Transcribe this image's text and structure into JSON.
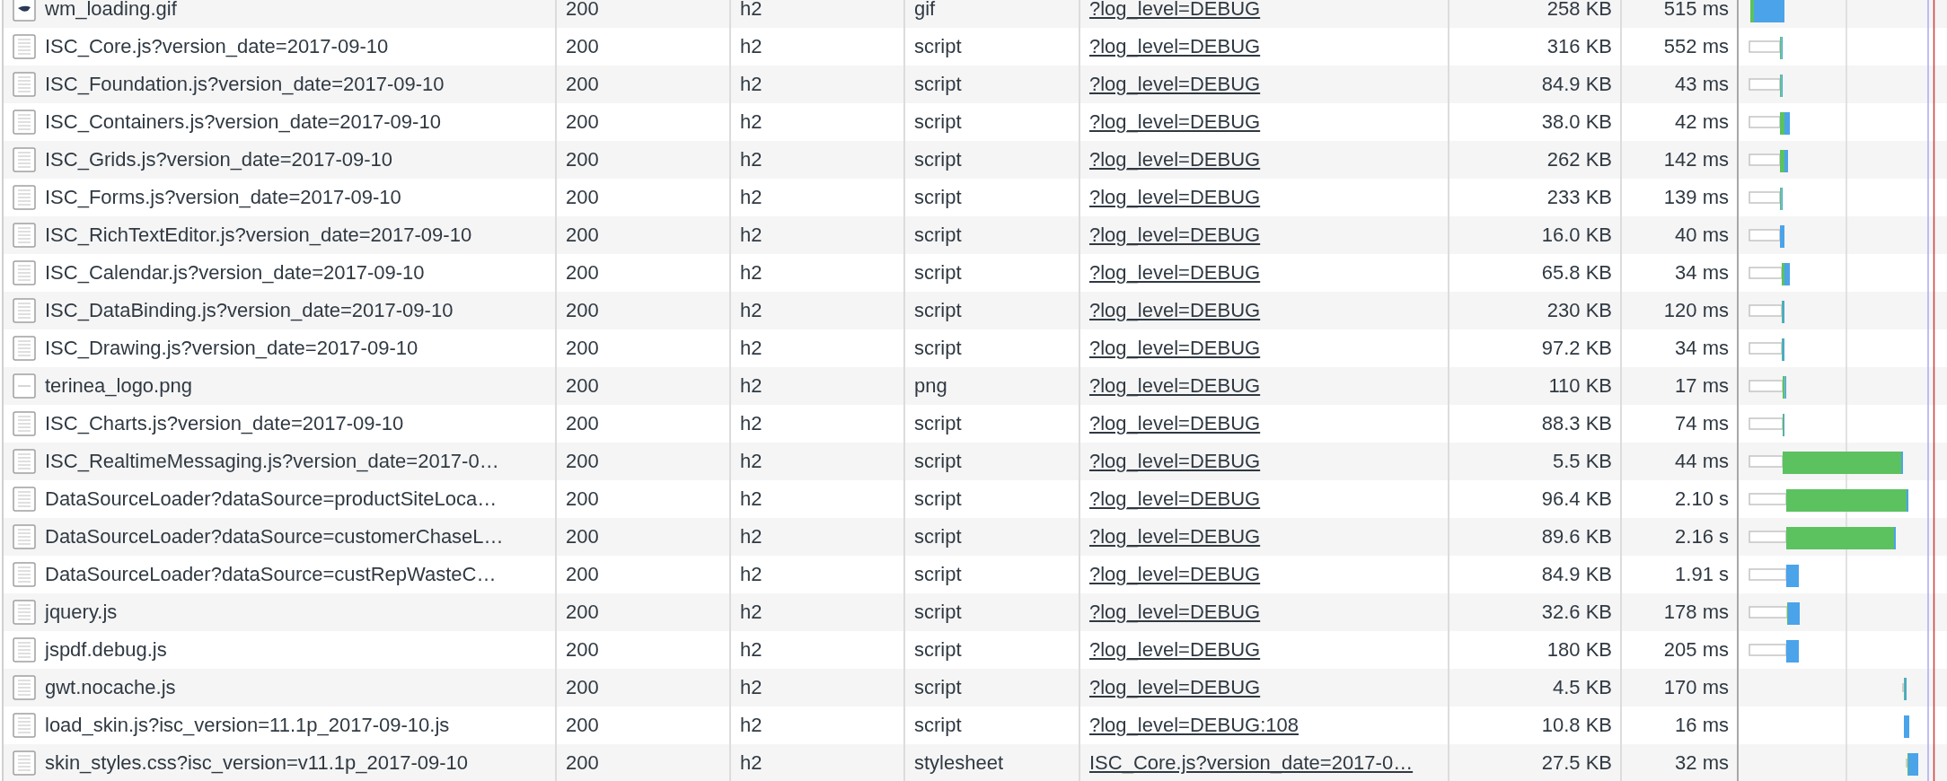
{
  "requests": [
    {
      "kind": "gif",
      "name": "wm_loading.gif",
      "status": "200",
      "protocol": "h2",
      "type": "gif",
      "initiator": "?log_level=DEBUG",
      "size": "258 KB",
      "time": "515 ms"
    },
    {
      "kind": "document",
      "name": "ISC_Core.js?version_date=2017-09-10",
      "status": "200",
      "protocol": "h2",
      "type": "script",
      "initiator": "?log_level=DEBUG",
      "size": "316 KB",
      "time": "552 ms"
    },
    {
      "kind": "document",
      "name": "ISC_Foundation.js?version_date=2017-09-10",
      "status": "200",
      "protocol": "h2",
      "type": "script",
      "initiator": "?log_level=DEBUG",
      "size": "84.9 KB",
      "time": "43 ms"
    },
    {
      "kind": "document",
      "name": "ISC_Containers.js?version_date=2017-09-10",
      "status": "200",
      "protocol": "h2",
      "type": "script",
      "initiator": "?log_level=DEBUG",
      "size": "38.0 KB",
      "time": "42 ms"
    },
    {
      "kind": "document",
      "name": "ISC_Grids.js?version_date=2017-09-10",
      "status": "200",
      "protocol": "h2",
      "type": "script",
      "initiator": "?log_level=DEBUG",
      "size": "262 KB",
      "time": "142 ms"
    },
    {
      "kind": "document",
      "name": "ISC_Forms.js?version_date=2017-09-10",
      "status": "200",
      "protocol": "h2",
      "type": "script",
      "initiator": "?log_level=DEBUG",
      "size": "233 KB",
      "time": "139 ms"
    },
    {
      "kind": "document",
      "name": "ISC_RichTextEditor.js?version_date=2017-09-10",
      "status": "200",
      "protocol": "h2",
      "type": "script",
      "initiator": "?log_level=DEBUG",
      "size": "16.0 KB",
      "time": "40 ms"
    },
    {
      "kind": "document",
      "name": "ISC_Calendar.js?version_date=2017-09-10",
      "status": "200",
      "protocol": "h2",
      "type": "script",
      "initiator": "?log_level=DEBUG",
      "size": "65.8 KB",
      "time": "34 ms"
    },
    {
      "kind": "document",
      "name": "ISC_DataBinding.js?version_date=2017-09-10",
      "status": "200",
      "protocol": "h2",
      "type": "script",
      "initiator": "?log_level=DEBUG",
      "size": "230 KB",
      "time": "120 ms"
    },
    {
      "kind": "document",
      "name": "ISC_Drawing.js?version_date=2017-09-10",
      "status": "200",
      "protocol": "h2",
      "type": "script",
      "initiator": "?log_level=DEBUG",
      "size": "97.2 KB",
      "time": "34 ms"
    },
    {
      "kind": "image",
      "name": "terinea_logo.png",
      "status": "200",
      "protocol": "h2",
      "type": "png",
      "initiator": "?log_level=DEBUG",
      "size": "110 KB",
      "time": "17 ms"
    },
    {
      "kind": "document",
      "name": "ISC_Charts.js?version_date=2017-09-10",
      "status": "200",
      "protocol": "h2",
      "type": "script",
      "initiator": "?log_level=DEBUG",
      "size": "88.3 KB",
      "time": "74 ms"
    },
    {
      "kind": "document",
      "name": "ISC_RealtimeMessaging.js?version_date=2017-0…",
      "status": "200",
      "protocol": "h2",
      "type": "script",
      "initiator": "?log_level=DEBUG",
      "size": "5.5 KB",
      "time": "44 ms"
    },
    {
      "kind": "document",
      "name": "DataSourceLoader?dataSource=productSiteLoca…",
      "status": "200",
      "protocol": "h2",
      "type": "script",
      "initiator": "?log_level=DEBUG",
      "size": "96.4 KB",
      "time": "2.10 s"
    },
    {
      "kind": "document",
      "name": "DataSourceLoader?dataSource=customerChaseL…",
      "status": "200",
      "protocol": "h2",
      "type": "script",
      "initiator": "?log_level=DEBUG",
      "size": "89.6 KB",
      "time": "2.16 s"
    },
    {
      "kind": "document",
      "name": "DataSourceLoader?dataSource=custRepWasteC…",
      "status": "200",
      "protocol": "h2",
      "type": "script",
      "initiator": "?log_level=DEBUG",
      "size": "84.9 KB",
      "time": "1.91 s"
    },
    {
      "kind": "document",
      "name": "jquery.js",
      "status": "200",
      "protocol": "h2",
      "type": "script",
      "initiator": "?log_level=DEBUG",
      "size": "32.6 KB",
      "time": "178 ms"
    },
    {
      "kind": "document",
      "name": "jspdf.debug.js",
      "status": "200",
      "protocol": "h2",
      "type": "script",
      "initiator": "?log_level=DEBUG",
      "size": "180 KB",
      "time": "205 ms"
    },
    {
      "kind": "document",
      "name": "gwt.nocache.js",
      "status": "200",
      "protocol": "h2",
      "type": "script",
      "initiator": "?log_level=DEBUG",
      "size": "4.5 KB",
      "time": "170 ms"
    },
    {
      "kind": "document",
      "name": "load_skin.js?isc_version=11.1p_2017-09-10.js",
      "status": "200",
      "protocol": "h2",
      "type": "script",
      "initiator": "?log_level=DEBUG:108",
      "size": "10.8 KB",
      "time": "16 ms"
    },
    {
      "kind": "document",
      "name": "skin_styles.css?isc_version=v11.1p_2017-09-10",
      "status": "200",
      "protocol": "h2",
      "type": "stylesheet",
      "initiator": "ISC_Core.js?version_date=2017-0…",
      "size": "27.5 KB",
      "time": "32 ms"
    }
  ]
}
